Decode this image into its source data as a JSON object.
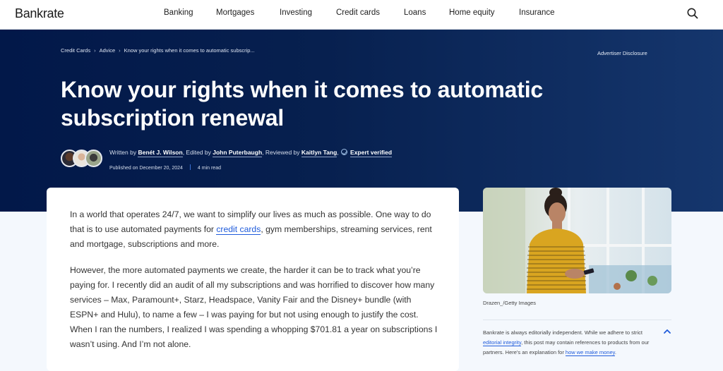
{
  "header": {
    "logo": "Bankrate",
    "nav": [
      {
        "label": "Banking"
      },
      {
        "label": "Mortgages"
      },
      {
        "label": "Investing"
      },
      {
        "label": "Credit cards"
      },
      {
        "label": "Loans"
      },
      {
        "label": "Home equity"
      },
      {
        "label": "Insurance"
      }
    ],
    "search_icon": "search-icon"
  },
  "hero": {
    "breadcrumb": [
      {
        "label": "Credit Cards"
      },
      {
        "label": "Advice"
      },
      {
        "label": "Know your rights when it comes to automatic subscrip..."
      }
    ],
    "breadcrumb_separator": "›",
    "advertiser_disclosure": "Advertiser Disclosure",
    "title": "Know your rights when it comes to automatic subscription renewal",
    "byline": {
      "written_by_label": "Written by",
      "author": "Benét J. Wilson",
      "edited_by_label": ", Edited by",
      "editor": "John Puterbaugh",
      "reviewed_by_label": ", Reviewed by",
      "reviewer": "Kaitlyn Tang",
      "comma": ",",
      "verified_label": "Expert verified"
    },
    "published": "Published on December 20, 2024",
    "read_time": "4 min read"
  },
  "article": {
    "p1_before": "In a world that operates 24/7, we want to simplify our lives as much as possible. One way to do that is to use automated payments for ",
    "p1_link": "credit cards",
    "p1_after": ", gym memberships, streaming services, rent and mortgage, subscriptions and more.",
    "p2": "However, the more automated payments we create, the harder it can be to track what you’re paying for. I recently did an audit of all my subscriptions and was horrified to discover how many services – Max, Paramount+, Starz, Headspace, Vanity Fair and the Disney+ bundle (with ESPN+ and Hulu), to name a few – I was paying for but not using enough to justify the cost. When I ran the numbers, I realized I was spending a whopping $701.81 a year on subscriptions I wasn’t using. And I’m not alone."
  },
  "sidebar": {
    "photo_alt": "Woman in striped yellow shirt looking at her phone",
    "photo_credit": "Drazen_/Getty Images",
    "independence_before": "Bankrate is always editorially independent. While we adhere to strict ",
    "independence_link1": "editorial integrity",
    "independence_middle": ", this post may contain references to products from our partners. Here's an explanation for ",
    "independence_link2": "how we make money",
    "independence_after": "."
  },
  "colors": {
    "brand_navy": "#021849",
    "link_blue": "#1f5bdb"
  }
}
